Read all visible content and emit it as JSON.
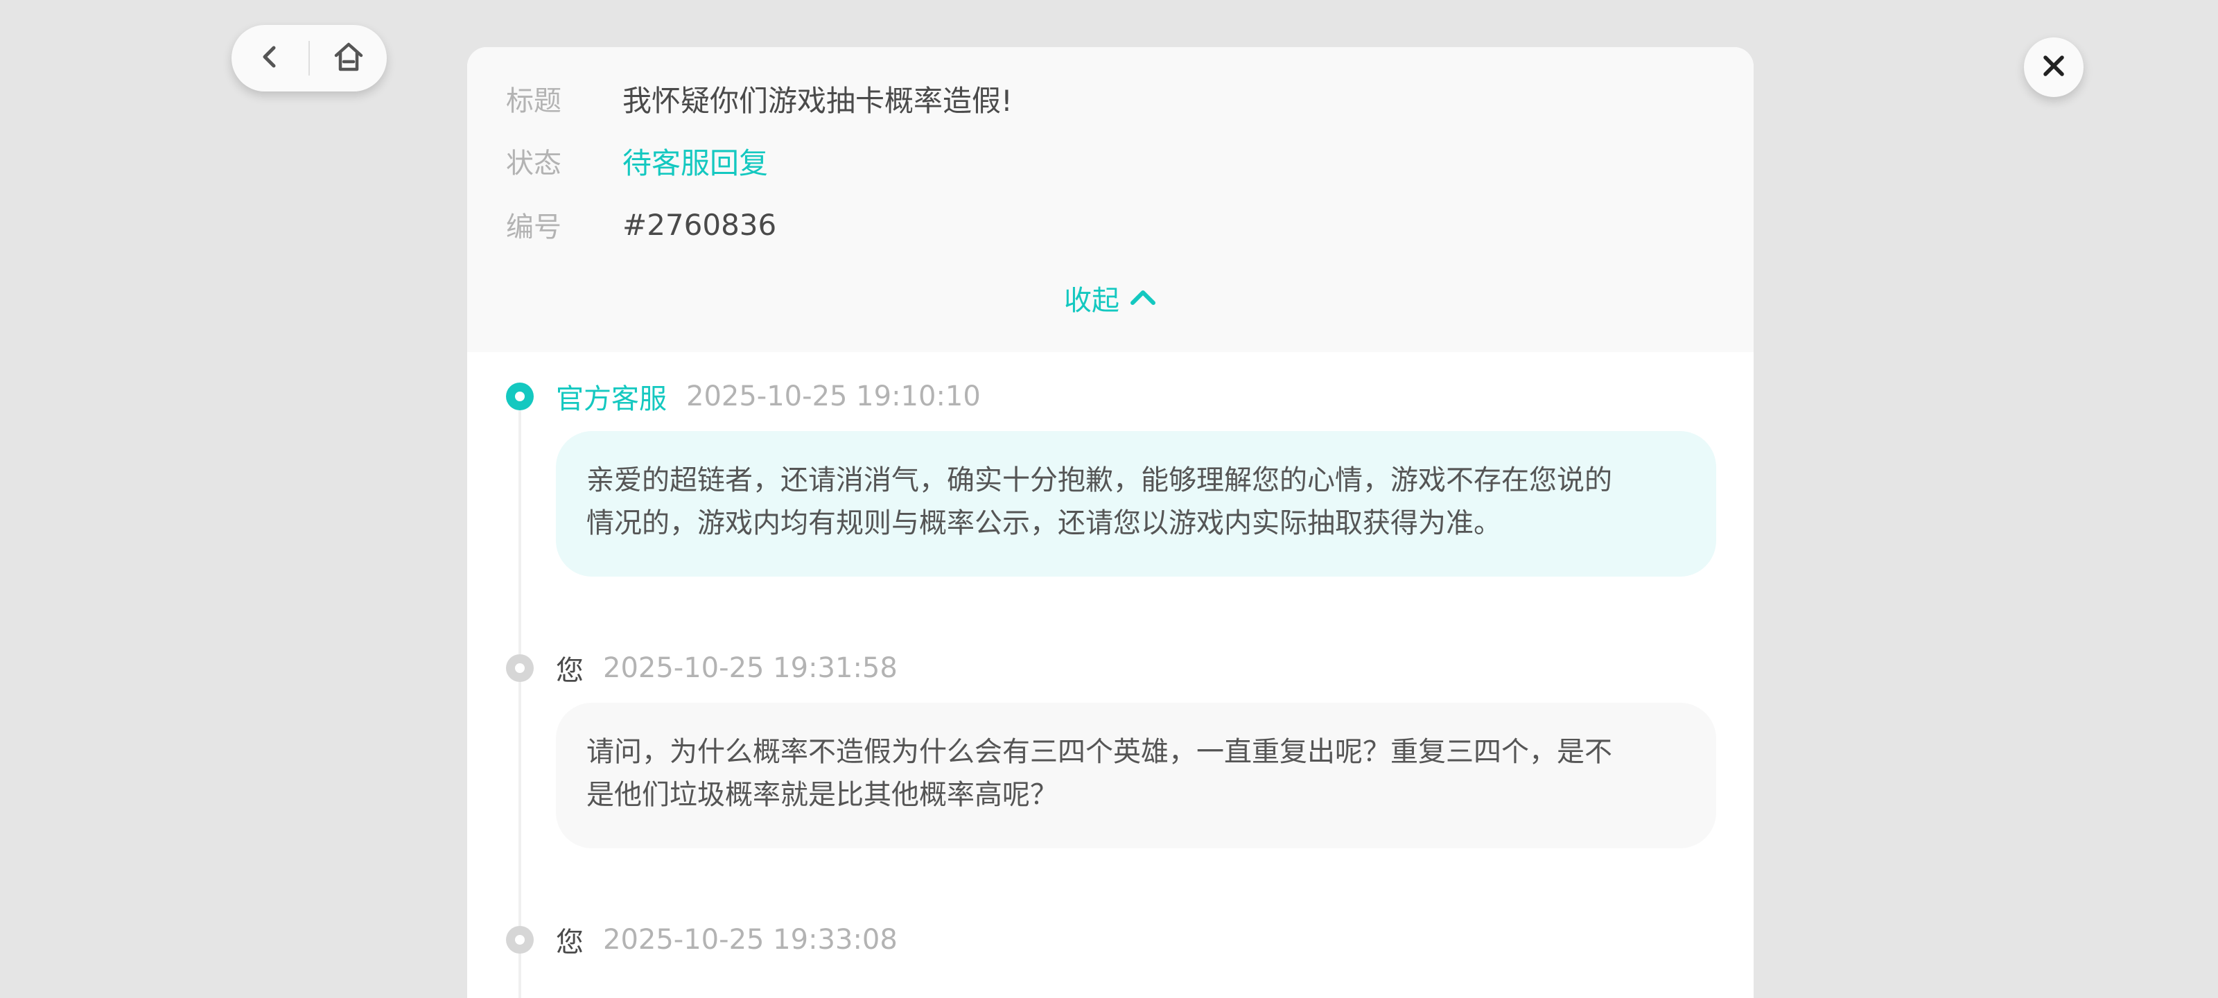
{
  "nav": {
    "back_icon": "chevron-left-icon",
    "home_icon": "home-icon"
  },
  "close_icon": "close-icon",
  "ticket": {
    "title_label": "标题",
    "title_value": "我怀疑你们游戏抽卡概率造假!",
    "status_label": "状态",
    "status_value": "待客服回复",
    "number_label": "编号",
    "number_value": "#2760836",
    "collapse_label": "收起",
    "collapse_icon": "chevron-up-icon"
  },
  "colors": {
    "accent": "#14c8c0",
    "background": "#e5e5e5",
    "info_panel": "#f9f9f9",
    "official_bubble": "#eafafa",
    "user_bubble": "#f8f8f8"
  },
  "messages": [
    {
      "sender": "官方客服",
      "time": "2025-10-25 19:10:10",
      "line1": "亲爱的超链者，还请消消气，确实十分抱歉，能够理解您的心情，游戏不存在您说的",
      "line2": "情况的，游戏内均有规则与概率公示，还请您以游戏内实际抽取获得为准。"
    },
    {
      "sender": "您",
      "time": "2025-10-25 19:31:58",
      "line1": "请问，为什么概率不造假为什么会有三四个英雄，一直重复出呢？重复三四个，是不",
      "line2": "是他们垃圾概率就是比其他概率高呢？"
    },
    {
      "sender": "您",
      "time": "2025-10-25 19:33:08"
    }
  ]
}
